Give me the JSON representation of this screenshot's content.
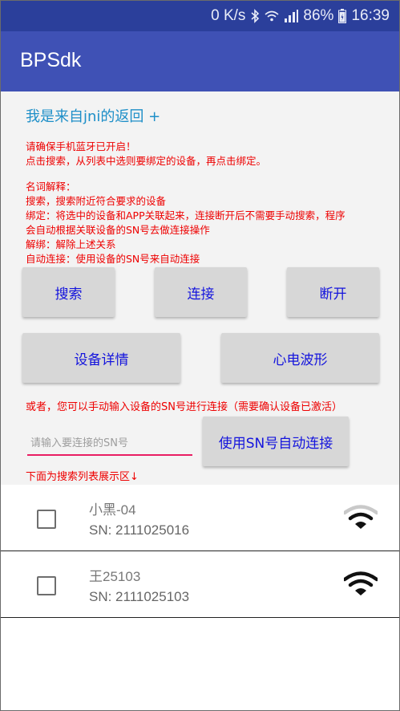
{
  "status_bar": {
    "speed": "0 K/s",
    "battery": "86%",
    "time": "16:39",
    "icons": [
      "bluetooth-icon",
      "wifi-status-icon",
      "signal-icon",
      "battery-icon"
    ]
  },
  "app_bar": {
    "title": "BPSdk"
  },
  "jni_text": "我是来自jni的返回 +",
  "instructions": {
    "line1": "请确保手机蓝牙已开启！",
    "line2": "点击搜索，从列表中选则要绑定的设备，再点击绑定。",
    "glossary_title": "名词解释：",
    "search_desc": "搜索，搜索附近符合要求的设备",
    "bind_desc_1": "绑定：将选中的设备和APP关联起来，连接断开后不需要手动搜索，程序",
    "bind_desc_2": "会自动根据关联设备的SN号去做连接操作",
    "unbind_desc": "解绑：解除上述关系",
    "autoconnect_desc": "自动连接：使用设备的SN号来自动连接"
  },
  "buttons": {
    "search": "搜索",
    "connect": "连接",
    "disconnect": "断开",
    "device_detail": "设备详情",
    "ecg_wave": "心电波形",
    "sn_connect": "使用SN号自动连接"
  },
  "sn_hint": "或者，您可以手动输入设备的SN号进行连接（需要确认设备已激活）",
  "sn_input": {
    "value": "",
    "placeholder": "请输入要连接的SN号"
  },
  "list_header": "下面为搜索列表展示区↓",
  "devices": [
    {
      "name": "小黑-04",
      "sn": "SN: 2111025016",
      "checked": false,
      "signal_level": 2,
      "signal_max": 3
    },
    {
      "name": "王25103",
      "sn": "SN: 2111025103",
      "checked": false,
      "signal_level": 3,
      "signal_max": 3
    }
  ],
  "colors": {
    "status_bar": "#2b3f9b",
    "app_bar": "#3f51b5",
    "jni_text": "#1e8fc8",
    "instruction_text": "#ee0000",
    "button_text": "#1414dd",
    "input_underline": "#e91e63"
  }
}
